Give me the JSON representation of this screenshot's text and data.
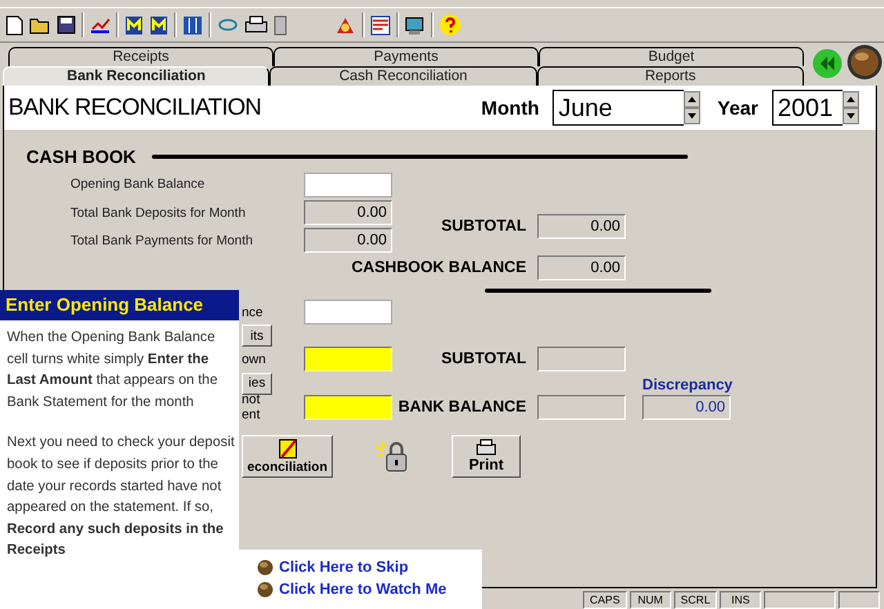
{
  "tabs": [
    [
      {
        "label": "Receipts",
        "selected": false
      },
      {
        "label": "Payments",
        "selected": false
      },
      {
        "label": "Budget",
        "selected": false
      }
    ],
    [
      {
        "label": "Bank Reconciliation",
        "selected": true
      },
      {
        "label": "Cash Reconciliation",
        "selected": false
      },
      {
        "label": "Reports",
        "selected": false
      }
    ]
  ],
  "header": {
    "title": "BANK RECONCILIATION",
    "month": {
      "label": "Month",
      "value": "June"
    },
    "year": {
      "label": "Year",
      "value": "2001"
    }
  },
  "cash_book": {
    "heading": "CASH BOOK",
    "rows": [
      {
        "label": "Opening Bank Balance",
        "value": "",
        "kind": "input"
      },
      {
        "label": "Total Bank Deposits for Month",
        "value": "0.00",
        "kind": "readonly"
      },
      {
        "label": "Total Bank Payments for Month",
        "value": "0.00",
        "kind": "readonly"
      }
    ],
    "subtotal": {
      "label": "SUBTOTAL",
      "value": "0.00"
    },
    "balance": {
      "label": "CASHBOOK BALANCE",
      "value": "0.00"
    }
  },
  "bank_statements": {
    "rows": [
      {
        "kind": "field",
        "label": "nce",
        "highlighted": false
      },
      {
        "kind": "button",
        "label": "its"
      },
      {
        "kind": "field",
        "label": "own",
        "highlighted": true
      },
      {
        "kind": "button",
        "label": "ies"
      },
      {
        "kind": "field",
        "label": "not ent",
        "highlighted": true
      }
    ],
    "subtotal": {
      "label": "SUBTOTAL"
    },
    "balance": {
      "label": "BANK BALANCE"
    },
    "discrepancy": {
      "label": "Discrepancy",
      "value": "0.00"
    }
  },
  "buttons": {
    "reconciliation": "econciliation",
    "print": "Print"
  },
  "tutorial": {
    "title": "Enter Opening Balance",
    "paragraphs": [
      "When the Opening Bank Balance cell turns white simply **Enter the Last Amount** that appears on the Bank Statement for the month",
      "Next you need to check your deposit book to see if deposits prior to the date your records started have not appeared on the statement. If so, **Record any such deposits in the Receipts**"
    ],
    "links": [
      "Click Here to Skip",
      "Click Here to Watch Me"
    ]
  },
  "status_bar": [
    "CAPS",
    "NUM",
    "SCRL",
    "INS"
  ]
}
